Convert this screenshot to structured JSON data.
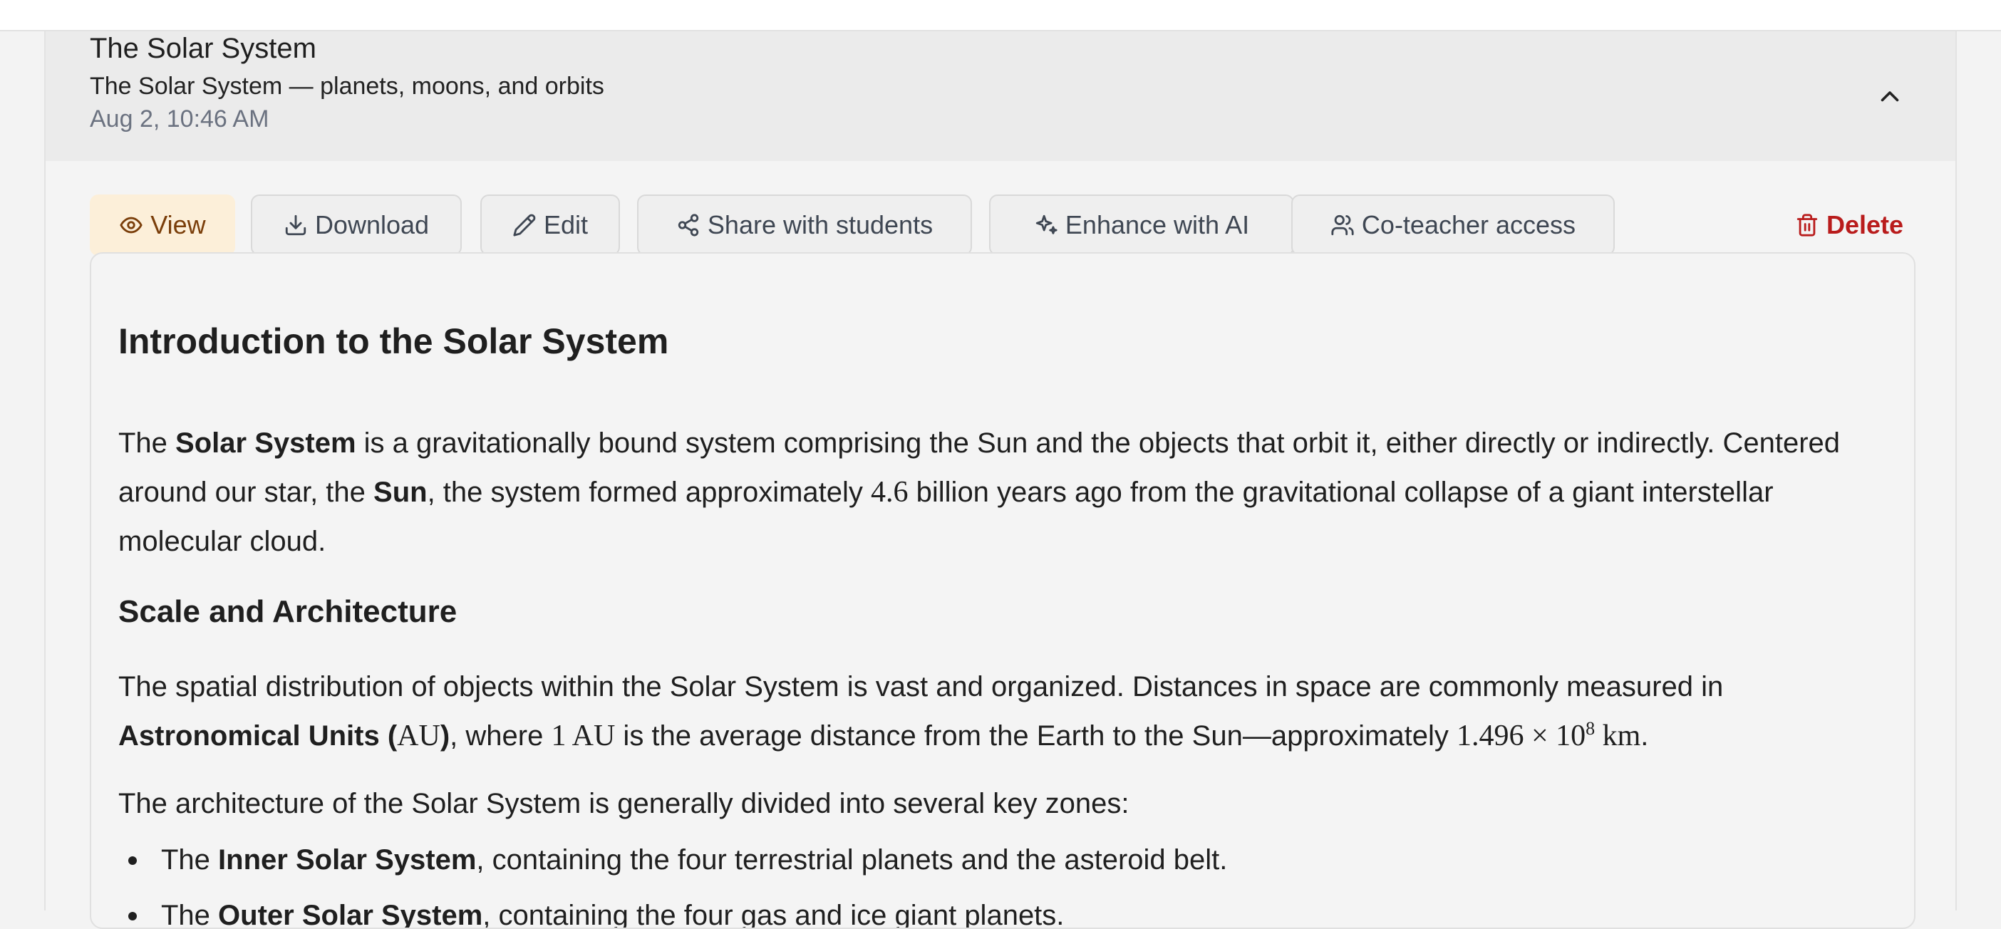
{
  "header": {
    "title": "The Solar System",
    "subtitle": "The Solar System — planets, moons, and orbits",
    "timestamp": "Aug 2, 10:46 AM"
  },
  "toolbar": {
    "view": "View",
    "download": "Download",
    "edit": "Edit",
    "share": "Share with students",
    "enhance": "Enhance with AI",
    "coteacher": "Co-teacher access",
    "delete": "Delete"
  },
  "colors": {
    "view_bg": "#fcefd9",
    "view_text": "#7a3e0a",
    "delete_text": "#b91c1c",
    "header_bg": "#ebebeb"
  },
  "document": {
    "h1": "Introduction to the Solar System",
    "intro": {
      "t1": "The ",
      "b1": "Solar System",
      "t2": " is a gravitationally bound system comprising the Sun and the objects that orbit it, either directly or indirectly. Centered around our star, the ",
      "b2": "Sun",
      "t3": ", the system formed approximately ",
      "m1": "4.6",
      "t4": " billion years ago from the gravitational collapse of a giant interstellar molecular cloud."
    },
    "h2": "Scale and Architecture",
    "scale": {
      "t1": "The spatial distribution of objects within the Solar System is vast and organized. Distances in space are commonly measured in ",
      "b1": "Astronomical Units (",
      "m1": "AU",
      "b2": ")",
      "t2": ", where ",
      "m2": "1 AU",
      "t3": " is the average distance from the Earth to the Sun—approximately ",
      "m3": "1.496 × 10",
      "m3_exp": "8",
      "m3_unit": " km",
      "t4": "."
    },
    "architecture": "The architecture of the Solar System is generally divided into several key zones:",
    "list": [
      {
        "pre": "The ",
        "bold": "Inner Solar System",
        "post": ", containing the four terrestrial planets and the asteroid belt."
      },
      {
        "pre": "The ",
        "bold": "Outer Solar System",
        "post": ", containing the four gas and ice giant planets."
      }
    ]
  }
}
